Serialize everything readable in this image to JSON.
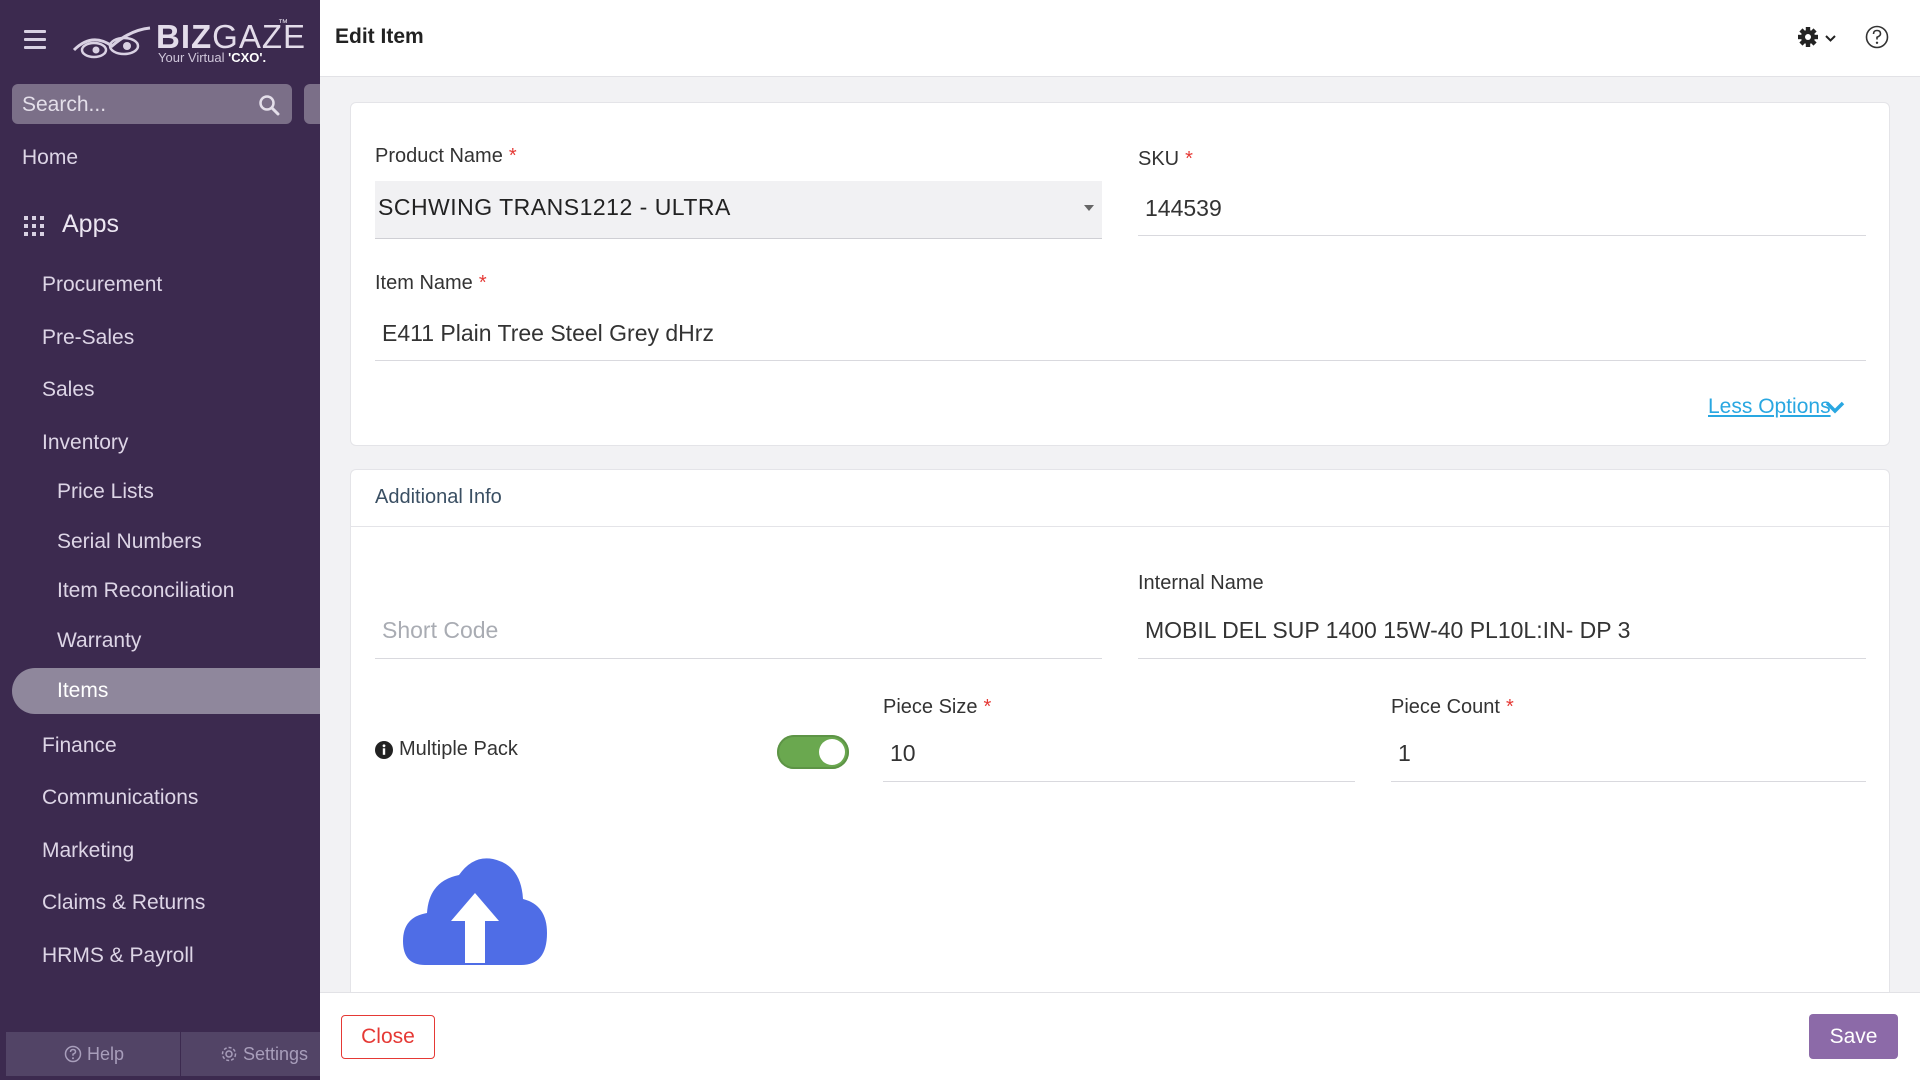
{
  "brand": {
    "name_bold": "BIZ",
    "name_light": "GAZE",
    "trademark": "™",
    "tagline_prefix": "Your Virtual ",
    "tagline_emphasis": "'CXO'."
  },
  "sidebar": {
    "search_placeholder": "Search...",
    "home": "Home",
    "apps_label": "Apps",
    "modules": {
      "procurement": "Procurement",
      "pre_sales": "Pre-Sales",
      "sales": "Sales",
      "inventory": "Inventory",
      "finance": "Finance",
      "communications": "Communications",
      "marketing": "Marketing",
      "claims_returns": "Claims & Returns",
      "hrms_payroll": "HRMS & Payroll"
    },
    "inventory_children": {
      "price_lists": "Price Lists",
      "serial_numbers": "Serial Numbers",
      "item_reconciliation": "Item Reconciliation",
      "warranty": "Warranty",
      "items": "Items"
    },
    "active_item": "Items",
    "footer": {
      "help": "Help",
      "settings": "Settings"
    }
  },
  "header": {
    "title": "Edit Item"
  },
  "form": {
    "required_mark": "*",
    "product_name": {
      "label": "Product Name",
      "value": "SCHWING TRANS1212 - ULTRA"
    },
    "sku": {
      "label": "SKU",
      "value": "144539"
    },
    "item_name": {
      "label": "Item Name",
      "value": "E411 Plain Tree Steel Grey dHrz"
    },
    "less_options": "Less Options"
  },
  "additional_info": {
    "title": "Additional Info",
    "short_code": {
      "placeholder": "Short Code",
      "value": ""
    },
    "internal_name": {
      "label": "Internal Name",
      "value": "MOBIL DEL SUP 1400 15W-40 PL10L:IN- DP 3"
    },
    "multiple_pack": {
      "label": "Multiple Pack",
      "enabled": true
    },
    "piece_size": {
      "label": "Piece Size",
      "value": "10"
    },
    "piece_count": {
      "label": "Piece Count",
      "value": "1"
    }
  },
  "footer": {
    "close_label": "Close",
    "save_label": "Save"
  },
  "colors": {
    "sidebar_bg": "#3c2a4f",
    "accent": "#8c6aa8",
    "close_red": "#e53935",
    "link_blue": "#29a7e1",
    "toggle_green": "#6aa84f",
    "upload_blue": "#4f6de6"
  },
  "icons": [
    "hamburger-icon",
    "search-icon",
    "apps-grid-icon",
    "gear-icon",
    "chevron-down-icon",
    "help-circle-icon",
    "info-icon",
    "cloud-upload-icon"
  ]
}
